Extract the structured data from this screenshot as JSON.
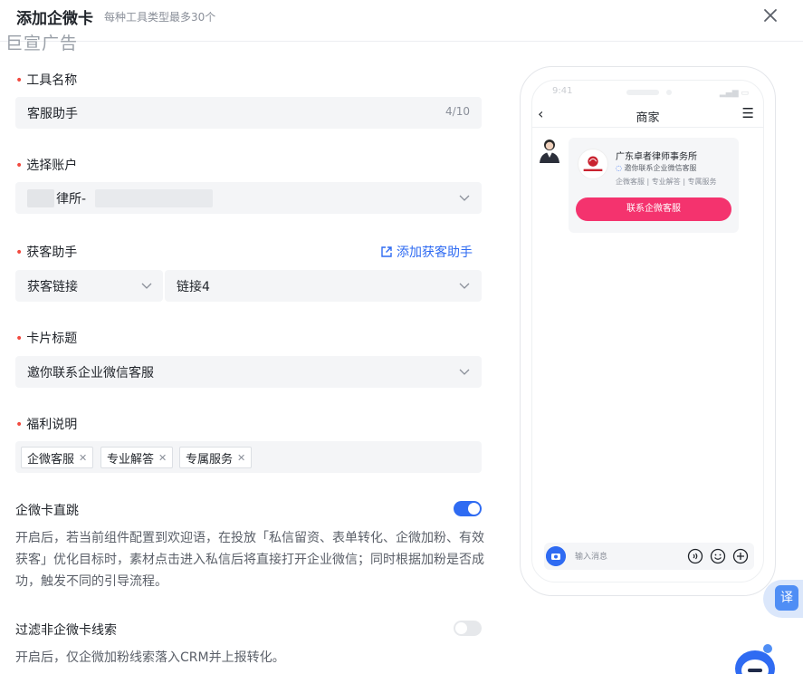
{
  "header": {
    "title": "添加企微卡",
    "subtitle": "每种工具类型最多30个",
    "watermark": "巨宣广告"
  },
  "form": {
    "tool_name": {
      "label": "工具名称",
      "value": "客服助手",
      "count": "4/10"
    },
    "account": {
      "label": "选择账户",
      "value": "律所-"
    },
    "assistant": {
      "label": "获客助手",
      "add_link": "添加获客助手",
      "type_value": "获客链接",
      "link_value": "链接4"
    },
    "card_title": {
      "label": "卡片标题",
      "value": "邀你联系企业微信客服"
    },
    "benefit": {
      "label": "福利说明",
      "tags": [
        "企微客服",
        "专业解答",
        "专属服务"
      ]
    },
    "direct_jump": {
      "title": "企微卡直跳",
      "enabled": true,
      "desc": "开启后，若当前组件配置到欢迎语，在投放「私信留资、表单转化、企微加粉、有效获客」优化目标时，素材点击进入私信后将直接打开企业微信；同时根据加粉是否成功，触发不同的引导流程。"
    },
    "filter": {
      "title": "过滤非企微卡线索",
      "enabled": false,
      "desc": "开启后，仅企微加粉线索落入CRM并上报转化。"
    }
  },
  "preview": {
    "time": "9:41",
    "nav_title": "商家",
    "card": {
      "name": "广东卓者律师事务所",
      "line2": "邀你联系企业微信客服",
      "line3": "企微客服 | 专业解答 | 专属服务",
      "cta": "联系企微客服"
    },
    "input_placeholder": "输入消息"
  },
  "floating": {
    "translate_label": "译"
  },
  "colors": {
    "accent": "#2f6bf2",
    "required": "#f24a3f",
    "cta": "#f4336e"
  }
}
